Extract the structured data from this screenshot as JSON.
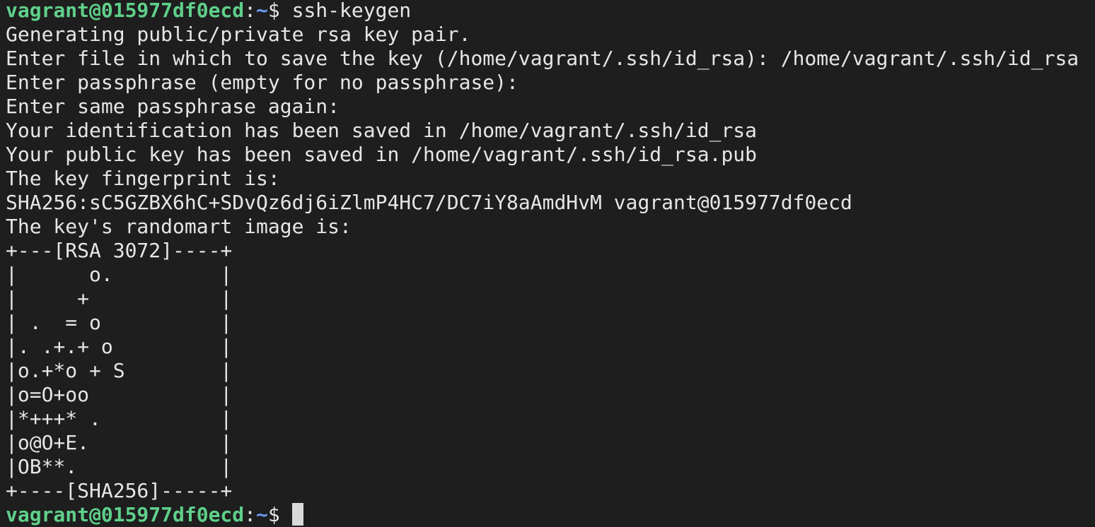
{
  "terminal": {
    "prompt_user_host": "vagrant@015977df0ecd",
    "prompt_colon": ":",
    "prompt_path": "~",
    "prompt_symbol": "$ ",
    "command": "ssh-keygen",
    "output_lines": [
      "Generating public/private rsa key pair.",
      "Enter file in which to save the key (/home/vagrant/.ssh/id_rsa): /home/vagrant/.ssh/id_rsa",
      "Enter passphrase (empty for no passphrase):",
      "Enter same passphrase again:",
      "Your identification has been saved in /home/vagrant/.ssh/id_rsa",
      "Your public key has been saved in /home/vagrant/.ssh/id_rsa.pub",
      "The key fingerprint is:",
      "SHA256:sC5GZBX6hC+SDvQz6dj6iZlmP4HC7/DC7iY8aAmdHvM vagrant@015977df0ecd",
      "The key's randomart image is:",
      "+---[RSA 3072]----+",
      "|      o.         |",
      "|     +           |",
      "| .  = o          |",
      "|. .+.+ o         |",
      "|o.+*o + S        |",
      "|o=O+oo           |",
      "|*+++* .          |",
      "|o@O+E.           |",
      "|OB**.            |",
      "+----[SHA256]-----+"
    ]
  },
  "colors": {
    "background": "#1e1e1e",
    "text": "#e6e6e6",
    "prompt_user": "#5fd08a",
    "prompt_path": "#6c9bf2",
    "cursor": "#d9d9d9"
  }
}
